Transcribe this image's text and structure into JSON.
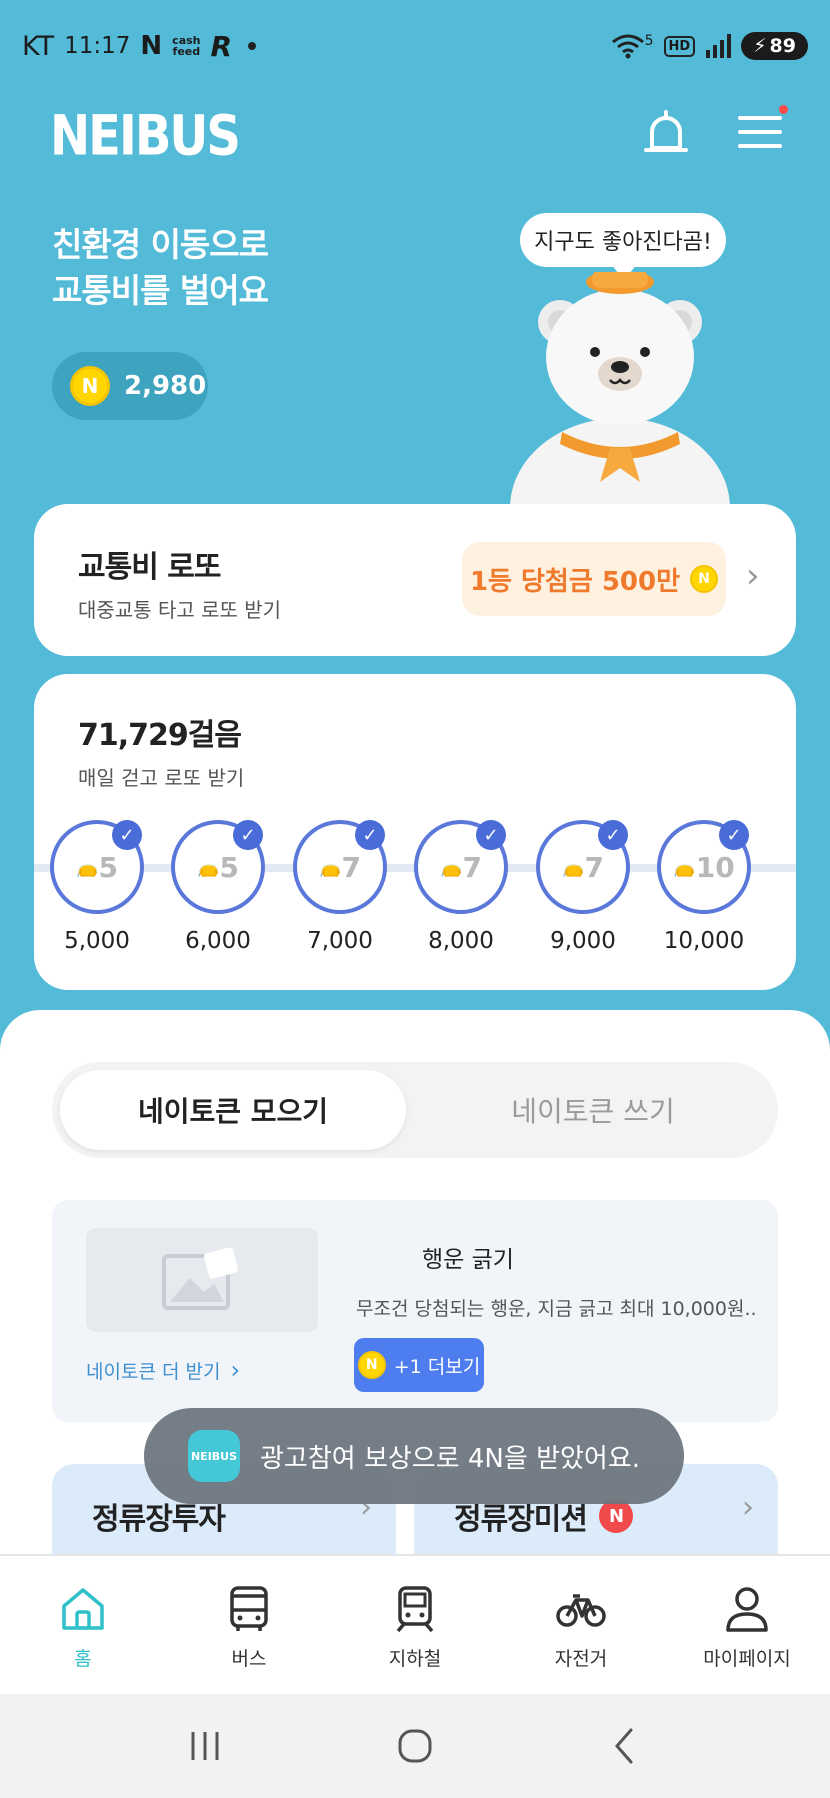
{
  "status_bar": {
    "carrier": "KT",
    "time": "11:17",
    "battery": "89",
    "network": "5",
    "hd": "HD"
  },
  "header": {
    "logo": "NEIBUS"
  },
  "hero": {
    "title_line1": "친환경 이동으로",
    "title_line2": "교통비를 벌어요",
    "coin_balance": "2,980",
    "coin_symbol": "N",
    "speech": "지구도 좋아진다곰!"
  },
  "lotto": {
    "title": "교통비 로또",
    "subtitle": "대중교통 타고 로또 받기",
    "prize": "1등 당첨금 500만"
  },
  "steps": {
    "title": "71,729걸음",
    "subtitle": "매일 걷고 로또 받기",
    "milestones": [
      {
        "reward": "5",
        "label": "5,000"
      },
      {
        "reward": "5",
        "label": "6,000"
      },
      {
        "reward": "7",
        "label": "7,000"
      },
      {
        "reward": "7",
        "label": "8,000"
      },
      {
        "reward": "7",
        "label": "9,000"
      },
      {
        "reward": "10",
        "label": "10,000"
      }
    ]
  },
  "tabs": {
    "active": "네이토큰 모으기",
    "inactive": "네이토큰 쓰기"
  },
  "offer": {
    "title": "행운 긁기",
    "description": "무조건 당첨되는 행운, 지금 긁고 최대 10,000원...",
    "button": "+1 더보기",
    "link": "네이토큰 더 받기"
  },
  "tiles": [
    {
      "title": "정류장투자"
    },
    {
      "title": "정류장미션",
      "badge": "N"
    }
  ],
  "toast": {
    "logo": "NEIBUS",
    "message": "광고참여 보상으로 4N을 받았어요."
  },
  "bottom_nav": [
    {
      "label": "홈",
      "icon": "home-icon"
    },
    {
      "label": "버스",
      "icon": "bus-icon"
    },
    {
      "label": "지하철",
      "icon": "subway-icon"
    },
    {
      "label": "자전거",
      "icon": "bicycle-icon"
    },
    {
      "label": "마이페이지",
      "icon": "person-icon"
    }
  ],
  "colors": {
    "background": "#53BBD8",
    "accent": "#2EC1C9",
    "step_blue": "#5A77DA",
    "prize_orange": "#F07A2C"
  }
}
